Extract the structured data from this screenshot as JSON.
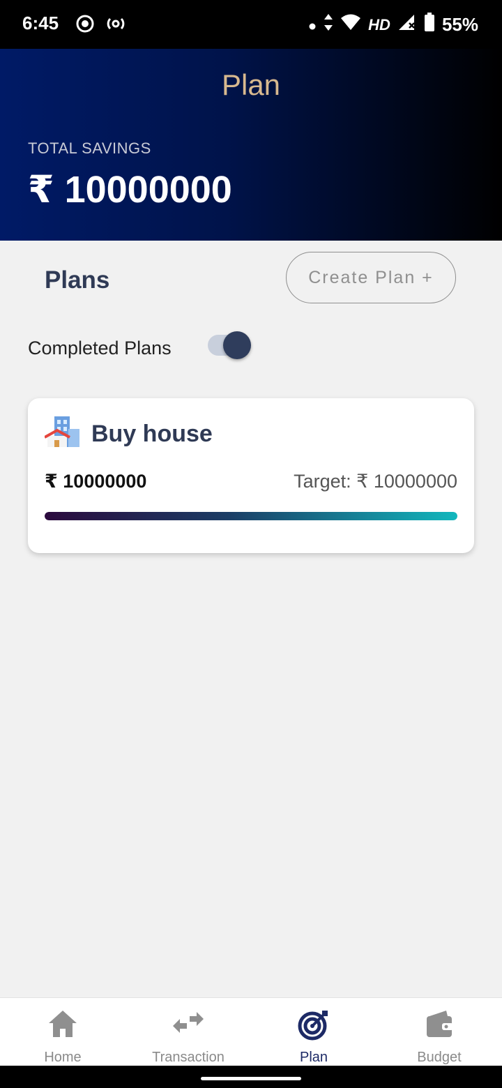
{
  "status_bar": {
    "time": "6:45",
    "network": "HD",
    "battery": "55%",
    "icons": [
      "record-icon",
      "hotspot-icon",
      "dot-icon",
      "data-arrows-icon",
      "wifi-icon",
      "signal-icon",
      "battery-icon"
    ]
  },
  "header": {
    "title": "Plan",
    "savings_label": "TOTAL SAVINGS",
    "savings_value": "₹ 10000000"
  },
  "plans": {
    "heading": "Plans",
    "create_button": "Create Plan +",
    "completed_label": "Completed Plans",
    "completed_toggle_on": true
  },
  "plan_cards": [
    {
      "icon": "house-icon",
      "title": "Buy house",
      "amount": "₹ 10000000",
      "target": "Target: ₹ 10000000",
      "progress": 1.0
    }
  ],
  "bottom_nav": {
    "items": [
      {
        "label": "Home",
        "icon": "home-icon",
        "active": false
      },
      {
        "label": "Transaction",
        "icon": "transfer-icon",
        "active": false
      },
      {
        "label": "Plan",
        "icon": "target-icon",
        "active": true
      },
      {
        "label": "Budget",
        "icon": "wallet-icon",
        "active": false
      }
    ]
  },
  "colors": {
    "header_gradient_start": "#001a66",
    "header_title": "#d8b98f",
    "accent_active": "#1d2a66",
    "progress_start": "#2b0a3d",
    "progress_end": "#12b7bd"
  }
}
